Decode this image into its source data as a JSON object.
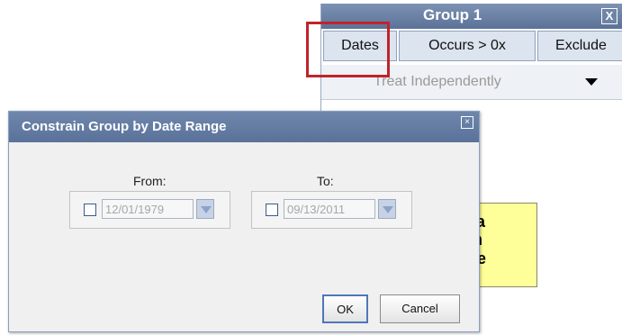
{
  "group": {
    "title": "Group 1",
    "close": "X",
    "tabs": [
      "Dates",
      "Occurs > 0x",
      "Exclude"
    ],
    "treat_label": "Treat Independently"
  },
  "note": {
    "lines": [
      "p a",
      "rm",
      "ere"
    ]
  },
  "dialog": {
    "title": "Constrain Group by Date Range",
    "close": "×",
    "from_label": "From:",
    "to_label": "To:",
    "from_value": "12/01/1979",
    "to_value": "09/13/2011",
    "ok_label": "OK",
    "cancel_label": "Cancel"
  },
  "colors": {
    "highlight": "#c0232b",
    "note_bg": "#ffff99",
    "titlebar": "#5a7299"
  }
}
